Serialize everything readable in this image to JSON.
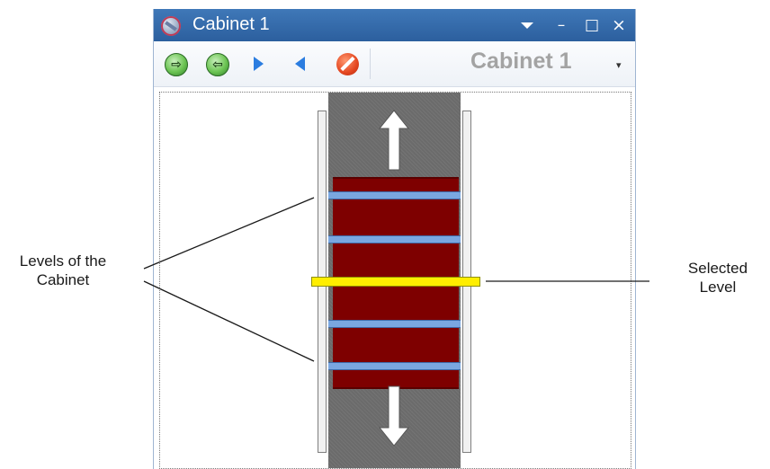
{
  "window": {
    "title": "Cabinet 1",
    "controls": {
      "dropdown_icon": "dropdown-arrow-icon",
      "minimize_glyph": "–",
      "maximize_glyph": "□",
      "close_glyph": "×"
    }
  },
  "toolbar": {
    "buttons": [
      {
        "name": "forward-circle",
        "icon": "arrow-right-circle-icon",
        "glyph": "⇨"
      },
      {
        "name": "back-circle",
        "icon": "arrow-left-circle-icon",
        "glyph": "⇦"
      },
      {
        "name": "play-right",
        "icon": "triangle-right-icon"
      },
      {
        "name": "play-left",
        "icon": "triangle-left-icon"
      },
      {
        "name": "stop",
        "icon": "stop-sign-icon"
      }
    ],
    "cabinet_selector": {
      "value": "Cabinet 1",
      "arrow_glyph": "▾"
    }
  },
  "cabinet_view": {
    "move_up_icon": "up-arrow-icon",
    "move_down_icon": "down-arrow-icon",
    "levels": 5,
    "selected_level": 3
  },
  "annotations": {
    "levels_label_line1": "Levels of the",
    "levels_label_line2": "Cabinet",
    "selected_label_line1": "Selected",
    "selected_label_line2": "Level"
  },
  "colors": {
    "titlebar": "#3169ac",
    "cabinet_body": "#7e0000",
    "level": "#7aa7e0",
    "selected_level": "#ffee00",
    "shaft": "#6b6b6b",
    "title_text_gray": "#a3a3a3"
  }
}
